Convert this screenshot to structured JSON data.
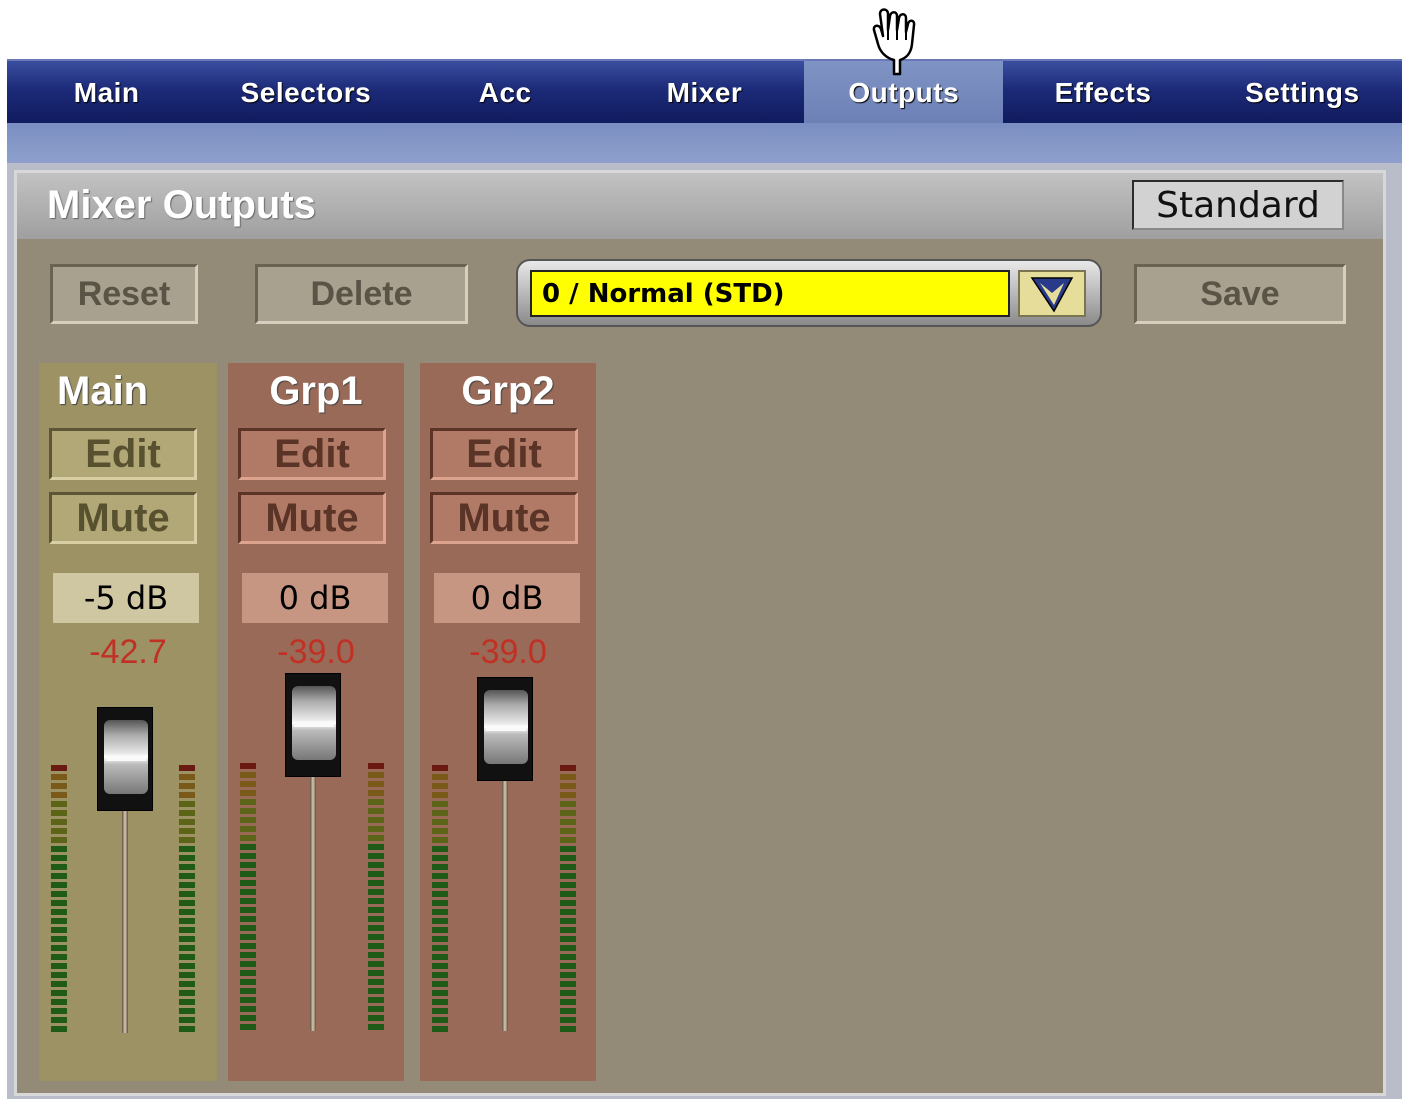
{
  "tabs": [
    {
      "label": "Main",
      "active": false
    },
    {
      "label": "Selectors",
      "active": false
    },
    {
      "label": "Acc",
      "active": false
    },
    {
      "label": "Mixer",
      "active": false
    },
    {
      "label": "Outputs",
      "active": true
    },
    {
      "label": "Effects",
      "active": false
    },
    {
      "label": "Settings",
      "active": false
    }
  ],
  "panel": {
    "title": "Mixer Outputs",
    "mode_button": "Standard",
    "reset_label": "Reset",
    "delete_label": "Delete",
    "save_label": "Save",
    "preset_value": "0 / Normal (STD)",
    "preset_dropdown_icon": "chevron-down-icon"
  },
  "channels": [
    {
      "name": "Main",
      "edit_label": "Edit",
      "mute_label": "Mute",
      "gain": "-5 dB",
      "level": "-42.7"
    },
    {
      "name": "Grp1",
      "edit_label": "Edit",
      "mute_label": "Mute",
      "gain": "0 dB",
      "level": "-39.0"
    },
    {
      "name": "Grp2",
      "edit_label": "Edit",
      "mute_label": "Mute",
      "gain": "0 dB",
      "level": "-39.0"
    }
  ],
  "colors": {
    "tab_bar": "#1c2a78",
    "tab_active": "#7f93c4",
    "preset_field": "#ffff00",
    "level_text": "#c03024",
    "main_strip": "#9c9264",
    "group_strip": "#9a6a58"
  }
}
